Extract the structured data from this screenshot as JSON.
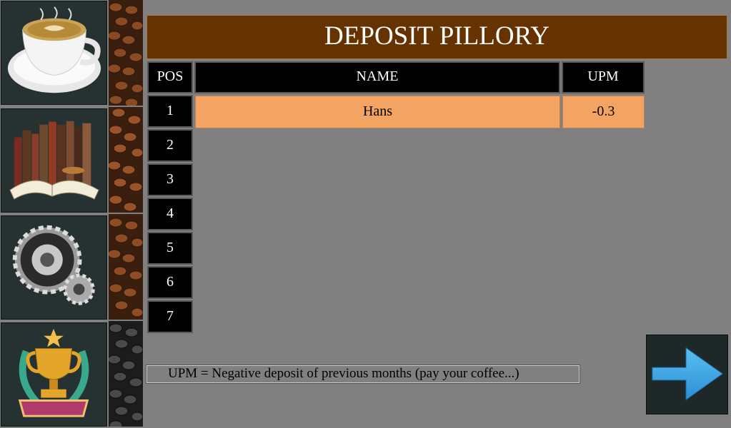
{
  "title": "DEPOSIT PILLORY",
  "table": {
    "headers": {
      "pos": "POS",
      "name": "NAME",
      "upm": "UPM"
    },
    "positions": [
      "1",
      "2",
      "3",
      "4",
      "5",
      "6",
      "7"
    ],
    "rows": [
      {
        "name": "Hans",
        "upm": "-0.3"
      }
    ]
  },
  "legend": "UPM = Negative deposit of previous months (pay your coffee...)",
  "sidebar": {
    "items": [
      {
        "icon": "coffee-cup-icon"
      },
      {
        "icon": "books-icon"
      },
      {
        "icon": "gears-icon"
      },
      {
        "icon": "trophy-icon"
      }
    ]
  },
  "colors": {
    "background": "#808080",
    "title_bg": "#663300",
    "header_bg": "#000000",
    "highlight_row": "#f4a462",
    "arrow": "#3aa4e6"
  }
}
